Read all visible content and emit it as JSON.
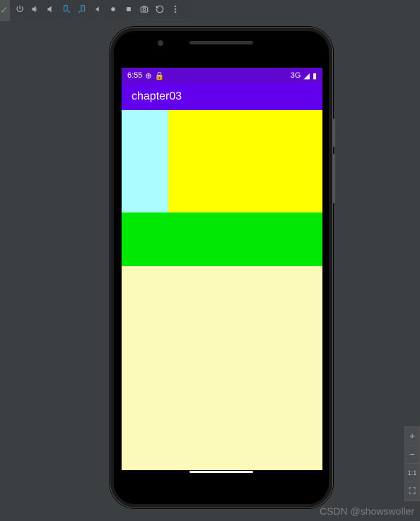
{
  "status_bar": {
    "time": "6:55",
    "network_label": "3G"
  },
  "app": {
    "title": "chapter03"
  },
  "zoom": {
    "in": "+",
    "out": "−",
    "fit": "1:1",
    "frame": "⛶"
  },
  "watermark": "CSDN @showswoller",
  "colors": {
    "status_bar": "#5f06d1",
    "app_bar": "#6200ee",
    "cyan": "#abfcff",
    "yellow": "#ffff00",
    "green": "#00e803",
    "pale": "#fbfab9"
  }
}
